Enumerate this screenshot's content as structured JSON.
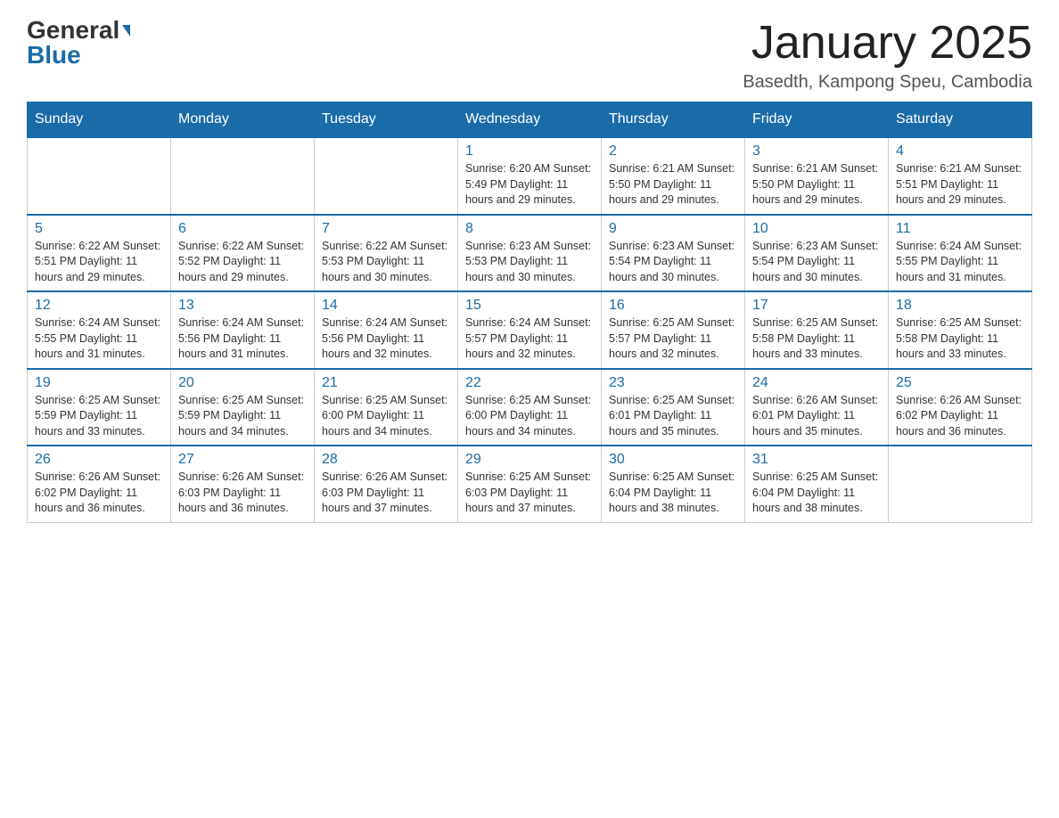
{
  "header": {
    "logo_general": "General",
    "logo_blue": "Blue",
    "title": "January 2025",
    "location": "Basedth, Kampong Speu, Cambodia"
  },
  "days_of_week": [
    "Sunday",
    "Monday",
    "Tuesday",
    "Wednesday",
    "Thursday",
    "Friday",
    "Saturday"
  ],
  "weeks": [
    [
      {
        "day": "",
        "info": ""
      },
      {
        "day": "",
        "info": ""
      },
      {
        "day": "",
        "info": ""
      },
      {
        "day": "1",
        "info": "Sunrise: 6:20 AM\nSunset: 5:49 PM\nDaylight: 11 hours\nand 29 minutes."
      },
      {
        "day": "2",
        "info": "Sunrise: 6:21 AM\nSunset: 5:50 PM\nDaylight: 11 hours\nand 29 minutes."
      },
      {
        "day": "3",
        "info": "Sunrise: 6:21 AM\nSunset: 5:50 PM\nDaylight: 11 hours\nand 29 minutes."
      },
      {
        "day": "4",
        "info": "Sunrise: 6:21 AM\nSunset: 5:51 PM\nDaylight: 11 hours\nand 29 minutes."
      }
    ],
    [
      {
        "day": "5",
        "info": "Sunrise: 6:22 AM\nSunset: 5:51 PM\nDaylight: 11 hours\nand 29 minutes."
      },
      {
        "day": "6",
        "info": "Sunrise: 6:22 AM\nSunset: 5:52 PM\nDaylight: 11 hours\nand 29 minutes."
      },
      {
        "day": "7",
        "info": "Sunrise: 6:22 AM\nSunset: 5:53 PM\nDaylight: 11 hours\nand 30 minutes."
      },
      {
        "day": "8",
        "info": "Sunrise: 6:23 AM\nSunset: 5:53 PM\nDaylight: 11 hours\nand 30 minutes."
      },
      {
        "day": "9",
        "info": "Sunrise: 6:23 AM\nSunset: 5:54 PM\nDaylight: 11 hours\nand 30 minutes."
      },
      {
        "day": "10",
        "info": "Sunrise: 6:23 AM\nSunset: 5:54 PM\nDaylight: 11 hours\nand 30 minutes."
      },
      {
        "day": "11",
        "info": "Sunrise: 6:24 AM\nSunset: 5:55 PM\nDaylight: 11 hours\nand 31 minutes."
      }
    ],
    [
      {
        "day": "12",
        "info": "Sunrise: 6:24 AM\nSunset: 5:55 PM\nDaylight: 11 hours\nand 31 minutes."
      },
      {
        "day": "13",
        "info": "Sunrise: 6:24 AM\nSunset: 5:56 PM\nDaylight: 11 hours\nand 31 minutes."
      },
      {
        "day": "14",
        "info": "Sunrise: 6:24 AM\nSunset: 5:56 PM\nDaylight: 11 hours\nand 32 minutes."
      },
      {
        "day": "15",
        "info": "Sunrise: 6:24 AM\nSunset: 5:57 PM\nDaylight: 11 hours\nand 32 minutes."
      },
      {
        "day": "16",
        "info": "Sunrise: 6:25 AM\nSunset: 5:57 PM\nDaylight: 11 hours\nand 32 minutes."
      },
      {
        "day": "17",
        "info": "Sunrise: 6:25 AM\nSunset: 5:58 PM\nDaylight: 11 hours\nand 33 minutes."
      },
      {
        "day": "18",
        "info": "Sunrise: 6:25 AM\nSunset: 5:58 PM\nDaylight: 11 hours\nand 33 minutes."
      }
    ],
    [
      {
        "day": "19",
        "info": "Sunrise: 6:25 AM\nSunset: 5:59 PM\nDaylight: 11 hours\nand 33 minutes."
      },
      {
        "day": "20",
        "info": "Sunrise: 6:25 AM\nSunset: 5:59 PM\nDaylight: 11 hours\nand 34 minutes."
      },
      {
        "day": "21",
        "info": "Sunrise: 6:25 AM\nSunset: 6:00 PM\nDaylight: 11 hours\nand 34 minutes."
      },
      {
        "day": "22",
        "info": "Sunrise: 6:25 AM\nSunset: 6:00 PM\nDaylight: 11 hours\nand 34 minutes."
      },
      {
        "day": "23",
        "info": "Sunrise: 6:25 AM\nSunset: 6:01 PM\nDaylight: 11 hours\nand 35 minutes."
      },
      {
        "day": "24",
        "info": "Sunrise: 6:26 AM\nSunset: 6:01 PM\nDaylight: 11 hours\nand 35 minutes."
      },
      {
        "day": "25",
        "info": "Sunrise: 6:26 AM\nSunset: 6:02 PM\nDaylight: 11 hours\nand 36 minutes."
      }
    ],
    [
      {
        "day": "26",
        "info": "Sunrise: 6:26 AM\nSunset: 6:02 PM\nDaylight: 11 hours\nand 36 minutes."
      },
      {
        "day": "27",
        "info": "Sunrise: 6:26 AM\nSunset: 6:03 PM\nDaylight: 11 hours\nand 36 minutes."
      },
      {
        "day": "28",
        "info": "Sunrise: 6:26 AM\nSunset: 6:03 PM\nDaylight: 11 hours\nand 37 minutes."
      },
      {
        "day": "29",
        "info": "Sunrise: 6:25 AM\nSunset: 6:03 PM\nDaylight: 11 hours\nand 37 minutes."
      },
      {
        "day": "30",
        "info": "Sunrise: 6:25 AM\nSunset: 6:04 PM\nDaylight: 11 hours\nand 38 minutes."
      },
      {
        "day": "31",
        "info": "Sunrise: 6:25 AM\nSunset: 6:04 PM\nDaylight: 11 hours\nand 38 minutes."
      },
      {
        "day": "",
        "info": ""
      }
    ]
  ]
}
